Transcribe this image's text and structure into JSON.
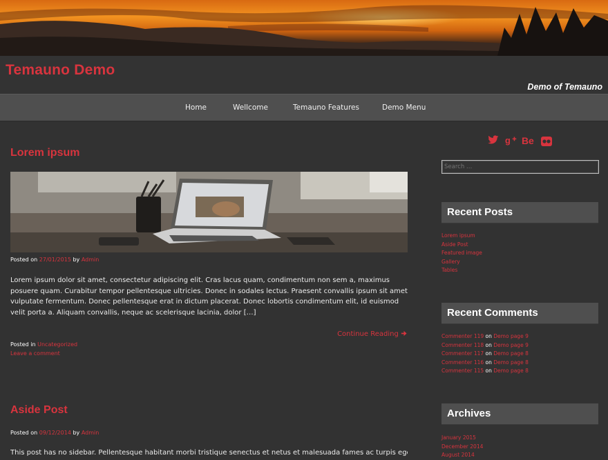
{
  "site": {
    "title": "Temauno Demo",
    "description": "Demo of Temauno"
  },
  "nav": {
    "items": [
      "Home",
      "Wellcome",
      "Temauno Features",
      "Demo Menu"
    ]
  },
  "posts": [
    {
      "title": "Lorem ipsum",
      "posted_on_label": "Posted on",
      "date": "27/01/2015",
      "by_label": "by",
      "author": "Admin",
      "excerpt": "Lorem ipsum dolor sit amet, consectetur adipiscing elit. Cras lacus quam, condimentum non sem a, maximus posuere quam. Curabitur tempor pellentesque ultricies. Donec in sodales lectus. Praesent convallis ipsum sit amet vulputate fermentum. Donec pellentesque erat in dictum placerat. Donec lobortis condimentum elit, id euismod velit porta a. Aliquam convallis, neque ac scelerisque lacinia, dolor […]",
      "continue_label": "Continue Reading",
      "posted_in_label": "Posted in",
      "category": "Uncategorized",
      "comment_link": "Leave a comment"
    },
    {
      "title": "Aside Post",
      "posted_on_label": "Posted on",
      "date": "09/12/2014",
      "by_label": "by",
      "author": "Admin",
      "excerpt": "This post has no sidebar. Pellentesque habitant morbi tristique senectus et netus et malesuada fames ac turpis egestas."
    }
  ],
  "sidebar": {
    "social_icons": [
      "twitter-icon",
      "google-plus-icon",
      "behance-icon",
      "flickr-icon"
    ],
    "search_placeholder": "Search …",
    "recent_posts": {
      "title": "Recent Posts",
      "items": [
        "Lorem ipsum",
        "Aside Post",
        "Featured image",
        "Gallery",
        "Tables"
      ]
    },
    "recent_comments": {
      "title": "Recent Comments",
      "on_label": "on",
      "items": [
        {
          "author": "Commenter 119",
          "post": "Demo page 9"
        },
        {
          "author": "Commenter 118",
          "post": "Demo page 9"
        },
        {
          "author": "Commenter 117",
          "post": "Demo page 8"
        },
        {
          "author": "Commenter 116",
          "post": "Demo page 8"
        },
        {
          "author": "Commenter 115",
          "post": "Demo page 8"
        }
      ]
    },
    "archives": {
      "title": "Archives",
      "items": [
        "January 2015",
        "December 2014",
        "August 2014"
      ]
    }
  },
  "colors": {
    "accent": "#d8343e",
    "background": "#323232",
    "nav_bar": "#4f4f4f",
    "widget_header": "#4f4f4f"
  }
}
